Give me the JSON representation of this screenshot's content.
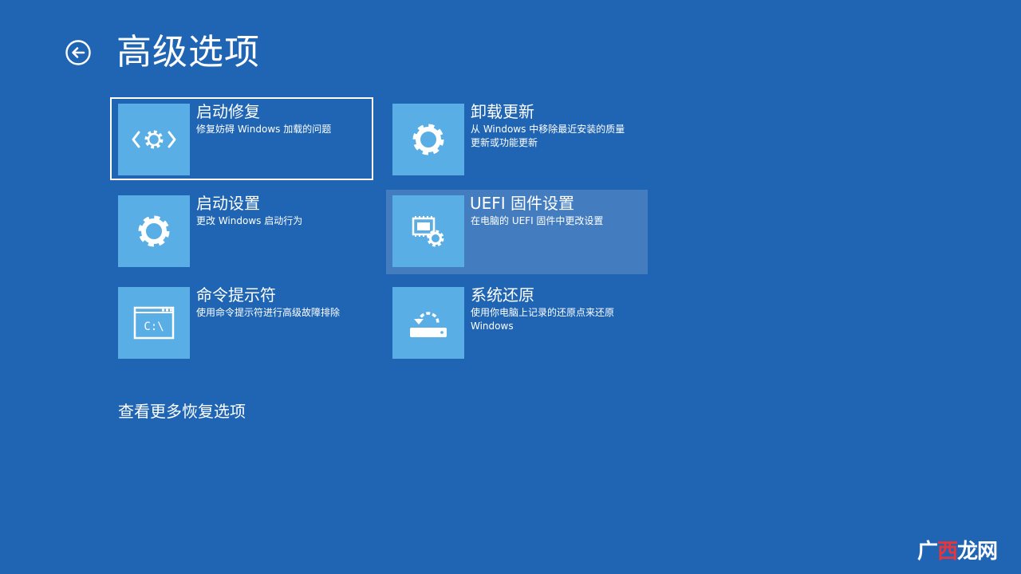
{
  "header": {
    "back_icon": "back-arrow-circle-icon",
    "title": "高级选项"
  },
  "options": [
    {
      "title": "启动修复",
      "description": "修复妨碍 Windows 加载的问题",
      "icon": "startup-repair-icon",
      "state": "selected"
    },
    {
      "title": "卸载更新",
      "description": "从 Windows 中移除最近安装的质量更新或功能更新",
      "icon": "gear-icon",
      "state": "normal"
    },
    {
      "title": "启动设置",
      "description": "更改 Windows 启动行为",
      "icon": "gear-icon",
      "state": "normal"
    },
    {
      "title": "UEFI 固件设置",
      "description": "在电脑的 UEFI 固件中更改设置",
      "icon": "firmware-chip-gear-icon",
      "state": "hover"
    },
    {
      "title": "命令提示符",
      "description": "使用命令提示符进行高级故障排除",
      "icon": "command-prompt-icon",
      "icon_text": "C:\\",
      "state": "normal"
    },
    {
      "title": "系统还原",
      "description": "使用你电脑上记录的还原点来还原 Windows",
      "icon": "system-restore-icon",
      "state": "normal"
    }
  ],
  "more_link": "查看更多恢复选项",
  "watermark": {
    "part1": "广",
    "part2": "西",
    "part3": "龙网"
  },
  "colors": {
    "background": "#1f65b4",
    "tile": "#5aaee6",
    "text": "#ffffff"
  }
}
